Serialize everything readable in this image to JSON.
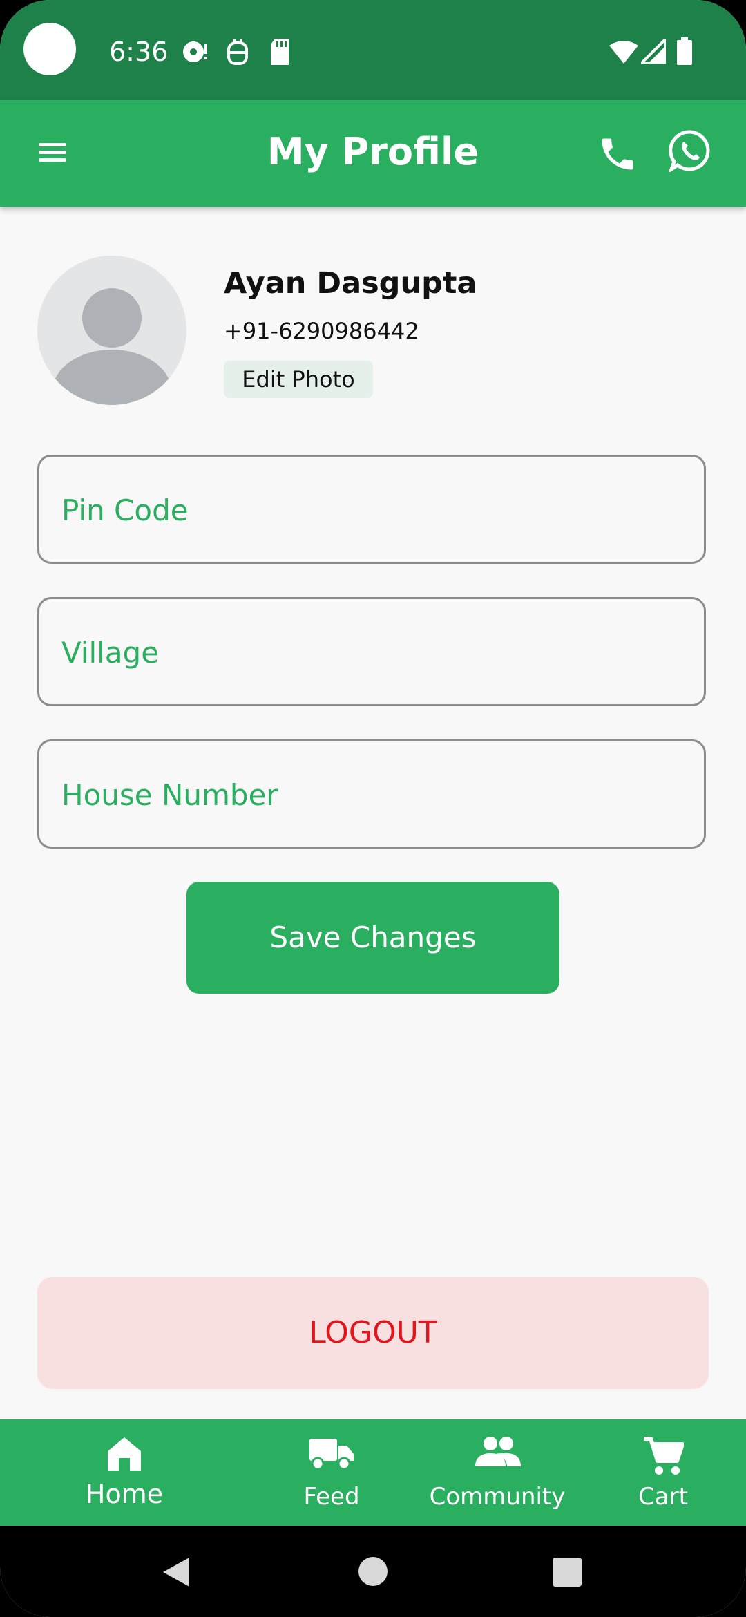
{
  "status_bar": {
    "time": "6:36"
  },
  "app_bar": {
    "title": "My Profile"
  },
  "profile": {
    "name": "Ayan Dasgupta",
    "phone": "+91-6290986442",
    "edit_photo_label": "Edit Photo"
  },
  "form": {
    "pin_code_placeholder": "Pin Code",
    "pin_code_value": "",
    "village_placeholder": "Village",
    "village_value": "",
    "house_number_placeholder": "House Number",
    "house_number_value": "",
    "save_label": "Save Changes"
  },
  "logout_label": "LOGOUT",
  "bottom_nav": {
    "items": [
      {
        "label": "Home",
        "icon": "home-icon"
      },
      {
        "label": "Feed",
        "icon": "truck-icon"
      },
      {
        "label": "Community",
        "icon": "people-icon"
      },
      {
        "label": "Cart",
        "icon": "cart-icon"
      }
    ]
  },
  "colors": {
    "status_bar": "#1e8149",
    "primary": "#2aae5f",
    "logout_bg": "#f8dfe0",
    "logout_text": "#e3151c"
  }
}
